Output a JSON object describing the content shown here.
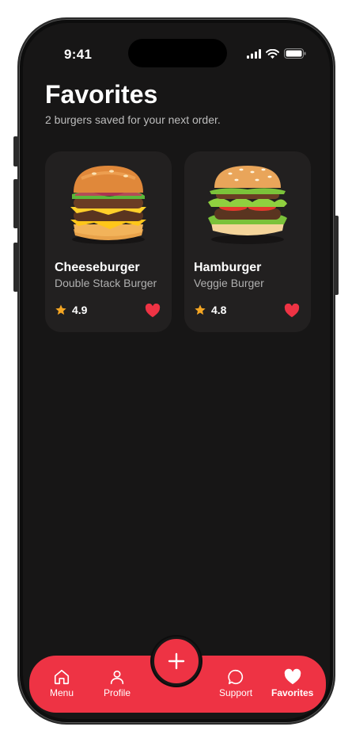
{
  "status": {
    "time": "9:41"
  },
  "header": {
    "title": "Favorites",
    "subtitle": "2 burgers saved for your next order."
  },
  "favorites": [
    {
      "name": "Cheeseburger",
      "description": "Double Stack Burger",
      "rating": "4.9"
    },
    {
      "name": "Hamburger",
      "description": "Veggie Burger",
      "rating": "4.8"
    }
  ],
  "nav": {
    "menu": "Menu",
    "profile": "Profile",
    "support": "Support",
    "favorites": "Favorites"
  },
  "colors": {
    "accent": "#ee3344",
    "background": "#171616",
    "card": "#222020",
    "star": "#f5a623"
  },
  "icons": [
    "home-icon",
    "user-icon",
    "plus-icon",
    "chat-bubble-icon",
    "heart-icon",
    "star-icon",
    "signal-icon",
    "wifi-icon",
    "battery-icon"
  ]
}
